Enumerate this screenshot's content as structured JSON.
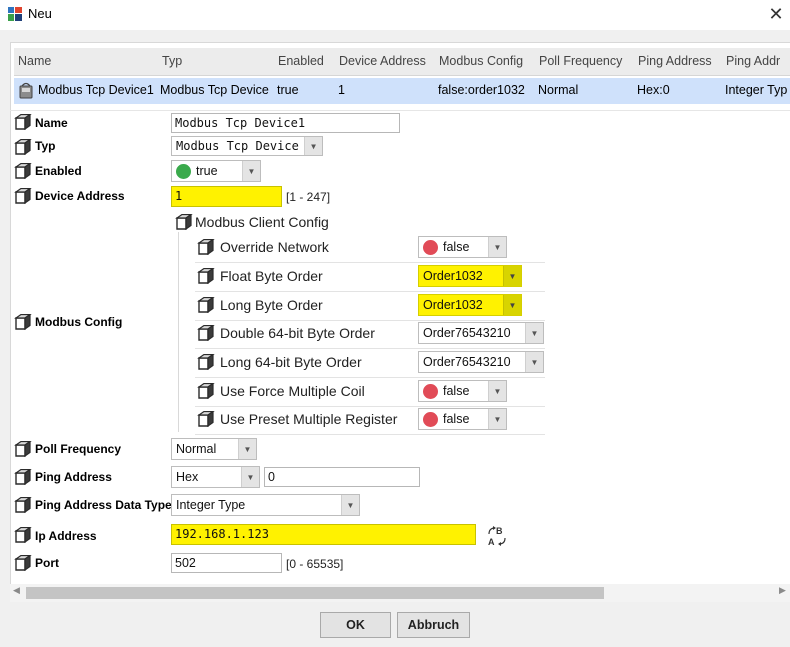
{
  "window": {
    "title": "Neu"
  },
  "table": {
    "headers": [
      "Name",
      "Typ",
      "Enabled",
      "Device Address",
      "Modbus Config",
      "Poll Frequency",
      "Ping Address",
      "Ping Addr"
    ],
    "row": [
      "Modbus Tcp Device1",
      "Modbus Tcp Device",
      "true",
      "1",
      "false:order1032",
      "Normal",
      "Hex:0",
      "Integer Typ"
    ]
  },
  "props": {
    "name": {
      "label": "Name",
      "value": "Modbus Tcp Device1"
    },
    "typ": {
      "label": "Typ",
      "value": "Modbus Tcp Device"
    },
    "enabled": {
      "label": "Enabled",
      "value": "true"
    },
    "device_address": {
      "label": "Device Address",
      "value": "1",
      "range": "[1 - 247]"
    },
    "modbus_config": {
      "label": "Modbus Config",
      "group_label": "Modbus Client Config",
      "items": [
        {
          "label": "Override Network",
          "value": "false"
        },
        {
          "label": "Float Byte Order",
          "value": "Order1032"
        },
        {
          "label": "Long Byte Order",
          "value": "Order1032"
        },
        {
          "label": "Double 64-bit Byte Order",
          "value": "Order76543210"
        },
        {
          "label": "Long 64-bit Byte Order",
          "value": "Order76543210"
        },
        {
          "label": "Use Force Multiple Coil",
          "value": "false"
        },
        {
          "label": "Use Preset Multiple Register",
          "value": "false"
        }
      ]
    },
    "poll_frequency": {
      "label": "Poll Frequency",
      "value": "Normal"
    },
    "ping_address": {
      "label": "Ping Address",
      "type": "Hex",
      "value": "0"
    },
    "ping_address_data_type": {
      "label": "Ping Address Data Type",
      "value": "Integer Type"
    },
    "ip_address": {
      "label": "Ip Address",
      "value": "192.168.1.123"
    },
    "port": {
      "label": "Port",
      "value": "502",
      "range": "[0 - 65535]"
    }
  },
  "buttons": {
    "ok": "OK",
    "cancel": "Abbruch"
  },
  "colors": {
    "highlight": "#fff200",
    "selection": "#cfe1fb",
    "true": "#3aaa4c",
    "false": "#e14b57"
  }
}
